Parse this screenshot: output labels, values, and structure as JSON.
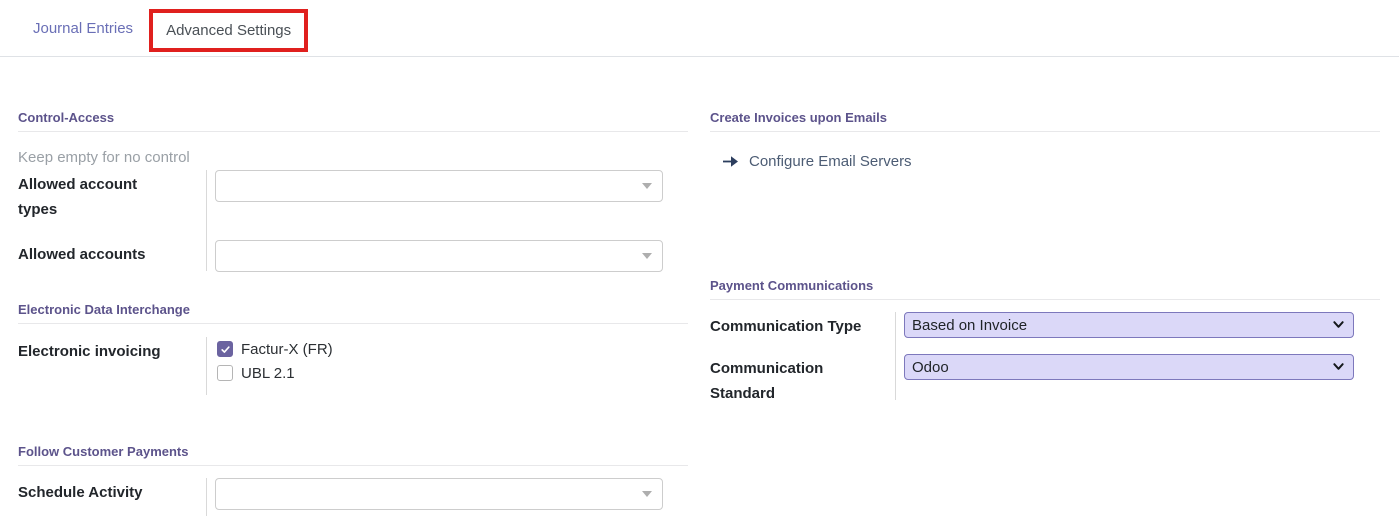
{
  "tabs": {
    "journal_entries": "Journal Entries",
    "advanced_settings": "Advanced Settings"
  },
  "left": {
    "control_access": {
      "title": "Control-Access",
      "hint": "Keep empty for no control",
      "fields": [
        {
          "label": "Allowed account types",
          "value": "",
          "placeholder": ""
        },
        {
          "label": "Allowed accounts",
          "value": "",
          "placeholder": ""
        }
      ]
    },
    "edi": {
      "title": "Electronic Data Interchange",
      "label": "Electronic invoicing",
      "options": [
        {
          "label": "Factur-X (FR)",
          "checked": true
        },
        {
          "label": "UBL 2.1",
          "checked": false
        }
      ]
    },
    "follow": {
      "title": "Follow Customer Payments",
      "field": {
        "label": "Schedule Activity",
        "value": "",
        "placeholder": ""
      }
    }
  },
  "right": {
    "emails": {
      "title": "Create Invoices upon Emails",
      "link": "Configure Email Servers"
    },
    "payment": {
      "title": "Payment Communications",
      "fields": [
        {
          "label": "Communication Type",
          "value": "Based on Invoice"
        },
        {
          "label": "Communication Standard",
          "value": "Odoo"
        }
      ]
    }
  },
  "icons": {
    "caret_down": "▾",
    "chevron_down": "⌄",
    "check": "✓",
    "arrow_right": "➜"
  },
  "colors": {
    "accent-purple": "#6b63a0",
    "section-title": "#5c538b",
    "highlight-red": "#e0201e",
    "select-bg": "#dbd8f8",
    "select-border": "#7d78bc",
    "tab-link": "#6a6fb6",
    "link-text": "#4c5c74",
    "arrow-dark": "#2c3e5e"
  }
}
